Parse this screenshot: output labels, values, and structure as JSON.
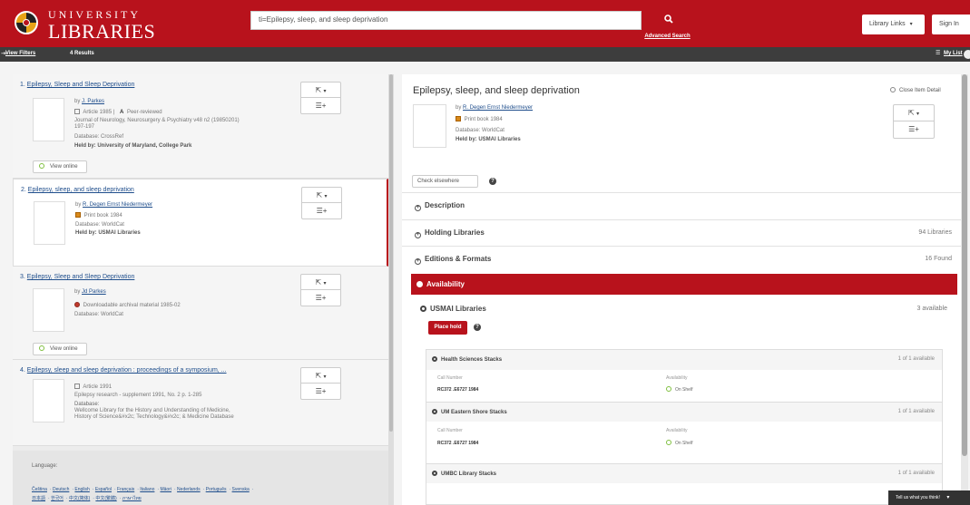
{
  "header": {
    "logo_line1": "UNIVERSITY",
    "logo_line2": "LIBRARIES",
    "search_value": "ti=Epilepsy, sleep, and sleep deprivation",
    "search_icon": "magnifier-icon",
    "advanced_search": "Advanced Search",
    "library_links": "Library Links",
    "sign_in": "Sign In",
    "brand_color": "#b8121c"
  },
  "subbar": {
    "view_filters": "View Filters",
    "results": "4 Results",
    "my_list": "My List"
  },
  "results": [
    {
      "number": "1.",
      "title": "Epilepsy, Sleep and Sleep Deprivation",
      "by": "by",
      "authors": "J. Parkes",
      "format": "Article 1985 |",
      "peer": "Peer-reviewed",
      "source1": "Journal of Neurology, Neurosurgery & Psychiatry v48 n2 (19850201)",
      "source2": "197-197",
      "database": "Database: CrossRef",
      "held": "Held by: University of Maryland, College Park",
      "button": "View online"
    },
    {
      "number": "2.",
      "title": "Epilepsy, sleep, and sleep deprivation",
      "by": "by",
      "authors": "R. Degen  Ernst Niedermeyer",
      "format": "Print book 1984",
      "database": "Database: WorldCat",
      "held": "Held by: USMAI Libraries"
    },
    {
      "number": "3.",
      "title": "Epilepsy, Sleep and Sleep Deprivation",
      "by": "by",
      "authors": "Jd Parkes",
      "format": "Downloadable archival material 1985-02",
      "database": "Database: WorldCat",
      "button": "View online"
    },
    {
      "number": "4.",
      "title": "Epilepsy, sleep and sleep deprivation : proceedings of a symposium, ...",
      "format": "Article 1991",
      "source1": "Epilepsy research - supplement 1991, No. 2 p. 1-285",
      "database_label": "Database:",
      "database_line1": "Wellcome Library for the History and Understanding of Medicine,",
      "database_line2": "History of Science&#x2c; Technology&#x2c; & Medicine Database"
    }
  ],
  "language": {
    "label": "Language:",
    "items": [
      "Čeština",
      "Deutsch",
      "English",
      "Español",
      "Français",
      "Italiano",
      "Māori",
      "Nederlands",
      "Português",
      "Svenska",
      "日本語",
      "한국어",
      "中文(简体)",
      "中文(繁體)",
      "ภาษาไทย"
    ]
  },
  "detail": {
    "title": "Epilepsy, sleep, and sleep deprivation",
    "close": "Close Item Detail",
    "by": "by",
    "authors": "R. Degen  Ernst Niedermeyer",
    "format": "Print book 1984",
    "database": "Database: WorldCat",
    "held": "Held by: USMAI Libraries",
    "check_elsewhere": "Check elsewhere",
    "description": "Description",
    "holding_libraries": "Holding Libraries",
    "holding_count": "94 Libraries",
    "editions": "Editions & Formats",
    "editions_count": "16 Found",
    "availability": "Availability",
    "usmai": "USMAI Libraries",
    "usmai_avail": "3 available",
    "place_hold": "Place hold",
    "col_call": "Call Number",
    "col_avail": "Availability",
    "stacks": [
      {
        "name": "Health Sciences Stacks",
        "count": "1 of 1 available",
        "call": "RC372 .E6727 1984",
        "status": "On Shelf"
      },
      {
        "name": "UM Eastern Shore Stacks",
        "count": "1 of 1 available",
        "call": "RC372 .E6727 1984",
        "status": "On Shelf"
      },
      {
        "name": "UMBC Library Stacks",
        "count": "1 of 1 available"
      }
    ]
  },
  "feedback": "Tell us what you think!"
}
